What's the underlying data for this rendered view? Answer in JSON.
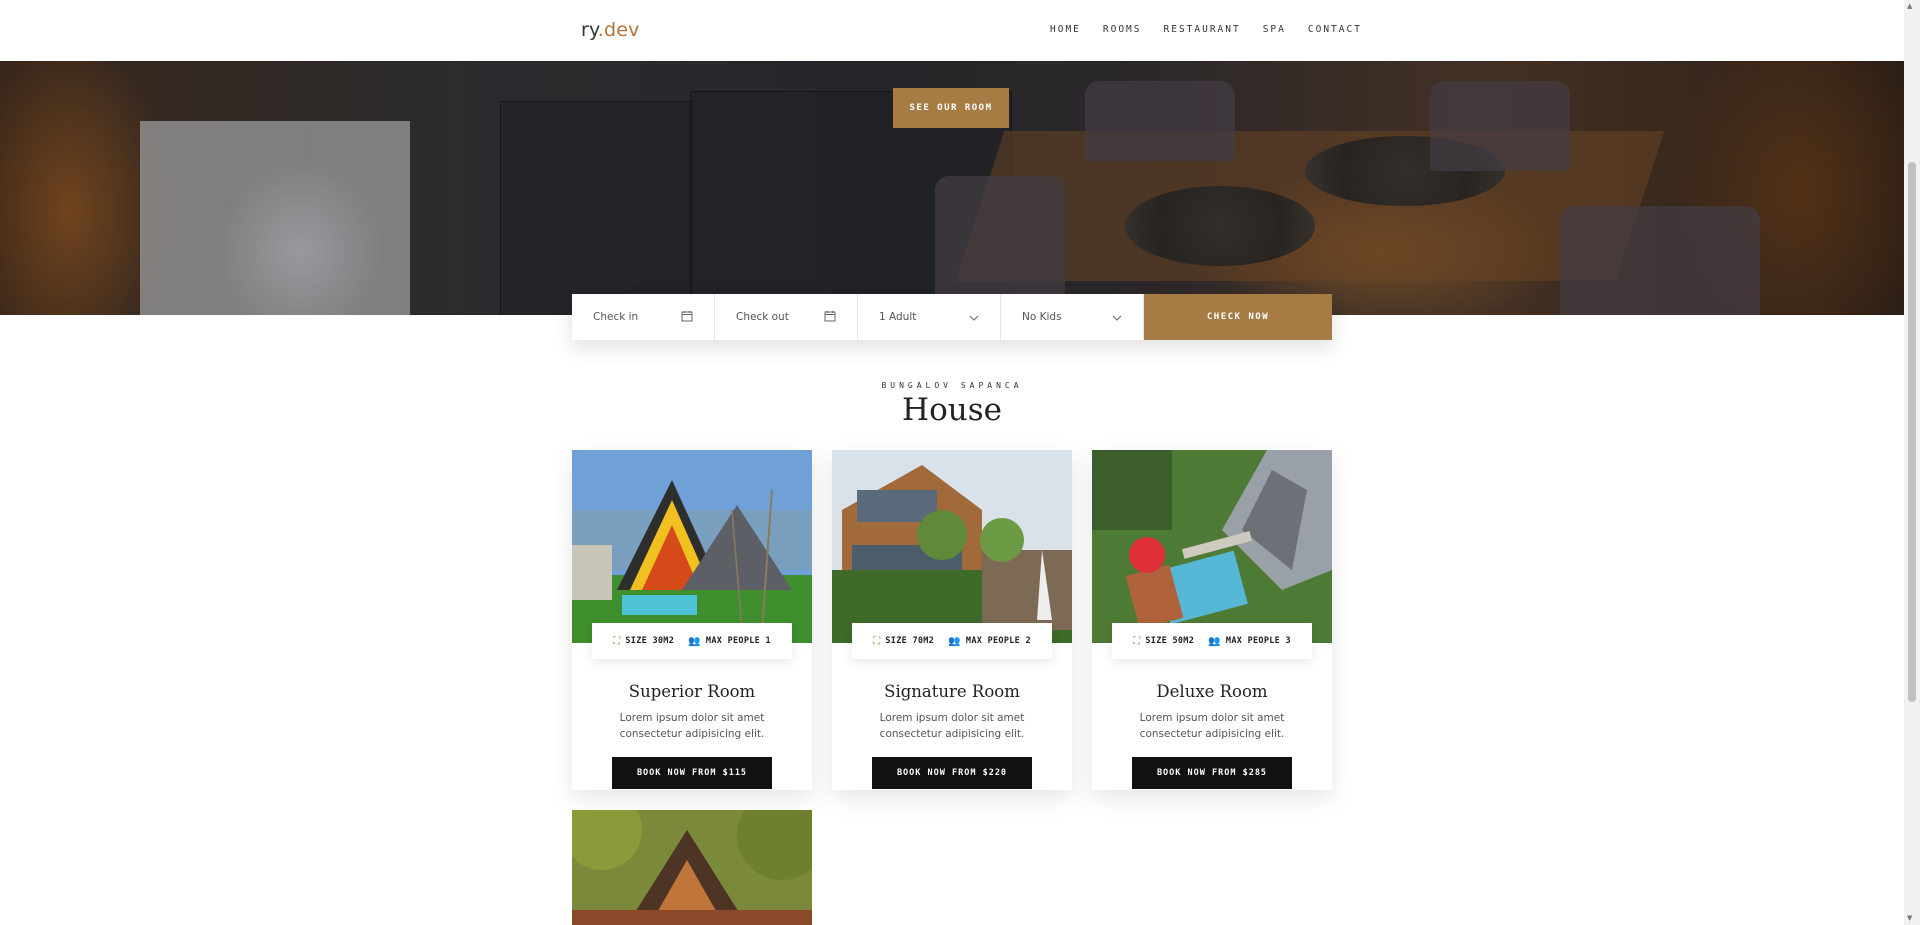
{
  "header": {
    "logo_prefix": "ry",
    "logo_suffix": ".dev",
    "nav": [
      "HOME",
      "ROOMS",
      "RESTAURANT",
      "SPA",
      "CONTACT"
    ]
  },
  "hero": {
    "button_label": "SEE OUR ROOM"
  },
  "booking": {
    "check_in": "Check in",
    "check_out": "Check out",
    "adults": "1 Adult",
    "kids": "No Kids",
    "button": "CHECK NOW",
    "icons": [
      "calendar-icon",
      "calendar-icon",
      "chevron-down-icon",
      "chevron-down-icon"
    ]
  },
  "section": {
    "subtitle": "BUNGALOV SAPANCA",
    "title": "House"
  },
  "rooms": [
    {
      "size": "SIZE 30M2",
      "people": "MAX PEOPLE 1",
      "name": "Superior Room",
      "desc": "Lorem ipsum dolor sit amet consectetur adipisicing elit.",
      "book": "BOOK NOW FROM $115"
    },
    {
      "size": "SIZE 70M2",
      "people": "MAX PEOPLE 2",
      "name": "Signature Room",
      "desc": "Lorem ipsum dolor sit amet consectetur adipisicing elit.",
      "book": "BOOK NOW FROM $220"
    },
    {
      "size": "SIZE 50M2",
      "people": "MAX PEOPLE 3",
      "name": "Deluxe Room",
      "desc": "Lorem ipsum dolor sit amet consectetur adipisicing elit.",
      "book": "BOOK NOW FROM $285"
    }
  ],
  "colors": {
    "accent": "#a67c44",
    "logo_accent": "#b5733a",
    "button_dark": "#111111"
  }
}
